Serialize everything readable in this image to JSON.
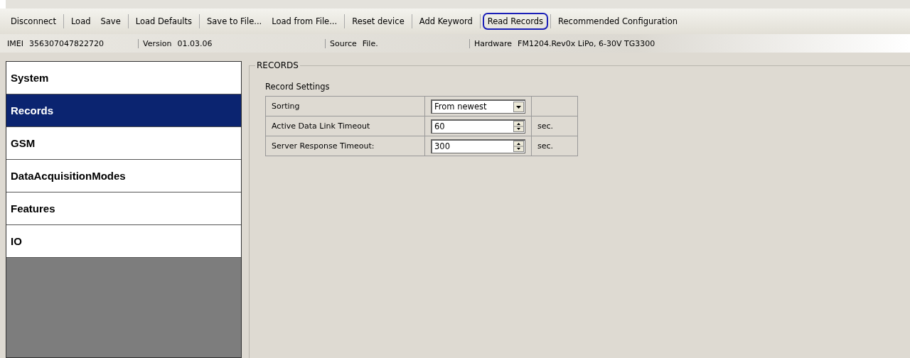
{
  "toolbar": {
    "groups": [
      [
        {
          "label": "Disconnect",
          "highlighted": false
        }
      ],
      [
        {
          "label": "Load",
          "highlighted": false
        },
        {
          "label": "Save",
          "highlighted": false
        }
      ],
      [
        {
          "label": "Load Defaults",
          "highlighted": false
        }
      ],
      [
        {
          "label": "Save to File...",
          "highlighted": false
        },
        {
          "label": "Load from File...",
          "highlighted": false
        }
      ],
      [
        {
          "label": "Reset device",
          "highlighted": false
        }
      ],
      [
        {
          "label": "Add Keyword",
          "highlighted": false
        }
      ],
      [
        {
          "label": "Read Records",
          "highlighted": true
        }
      ],
      [
        {
          "label": "Recommended Configuration",
          "highlighted": false
        }
      ]
    ]
  },
  "info_bar": [
    {
      "label": "IMEI",
      "value": "356307047822720"
    },
    {
      "label": "Version",
      "value": "01.03.06"
    },
    {
      "label": "Source",
      "value": "File."
    },
    {
      "label": "Hardware",
      "value": "FM1204.Rev0x LiPo, 6-30V TG3300"
    }
  ],
  "sidebar": {
    "items": [
      {
        "label": "System",
        "selected": false
      },
      {
        "label": "Records",
        "selected": true
      },
      {
        "label": "GSM",
        "selected": false
      },
      {
        "label": "DataAcquisitionModes",
        "selected": false
      },
      {
        "label": "Features",
        "selected": false
      },
      {
        "label": "IO",
        "selected": false
      }
    ]
  },
  "panel": {
    "title": "RECORDS",
    "section": "Record Settings",
    "rows": [
      {
        "kind": "dropdown",
        "label": "Sorting",
        "value": "From newest"
      },
      {
        "kind": "spinner",
        "label": "Active Data Link Timeout",
        "value": "60",
        "unit": "sec."
      },
      {
        "kind": "spinner",
        "label": "Server Response Timeout:",
        "value": "300",
        "unit": "sec."
      }
    ]
  }
}
